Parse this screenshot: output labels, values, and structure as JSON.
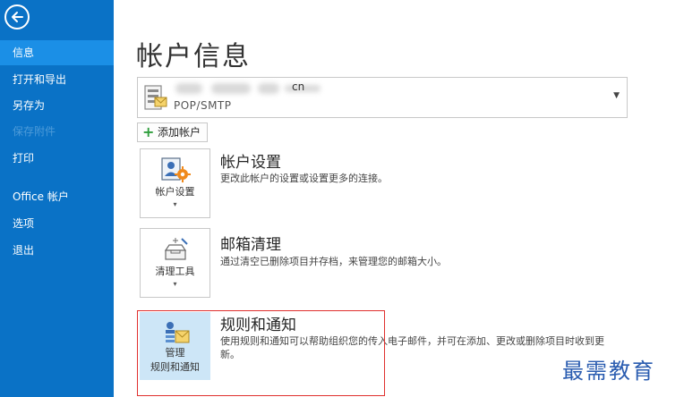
{
  "sidebar": {
    "items": [
      {
        "label": "信息",
        "state": "active"
      },
      {
        "label": "打开和导出",
        "state": "normal"
      },
      {
        "label": "另存为",
        "state": "normal"
      },
      {
        "label": "保存附件",
        "state": "disabled"
      },
      {
        "label": "打印",
        "state": "normal"
      },
      {
        "label": "Office 帐户",
        "state": "normal"
      },
      {
        "label": "选项",
        "state": "normal"
      },
      {
        "label": "退出",
        "state": "normal"
      }
    ]
  },
  "main": {
    "title": "帐户信息",
    "account": {
      "email_visible": "cn",
      "type": "POP/SMTP"
    },
    "add_account_label": "添加帐户",
    "sections": [
      {
        "tile_label": "帐户设置",
        "title": "帐户设置",
        "description": "更改此帐户的设置或设置更多的连接。"
      },
      {
        "tile_label": "清理工具",
        "title": "邮箱清理",
        "description": "通过清空已删除项目并存档，来管理您的邮箱大小。"
      },
      {
        "tile_label_line1": "管理",
        "tile_label_line2": "规则和通知",
        "title": "规则和通知",
        "description_line1": "使用规则和通知可以帮助组织您的传入电子邮件，并可在添加、更改或删除项目时收到更",
        "description_line2": "新。"
      }
    ]
  },
  "watermark": "最需教育",
  "colors": {
    "sidebar_bg": "#0a72c6",
    "sidebar_active": "#1b8fe6",
    "highlight_border": "#e0302e",
    "rules_tile_bg": "#cde6f7",
    "watermark": "#2a5cb0"
  }
}
